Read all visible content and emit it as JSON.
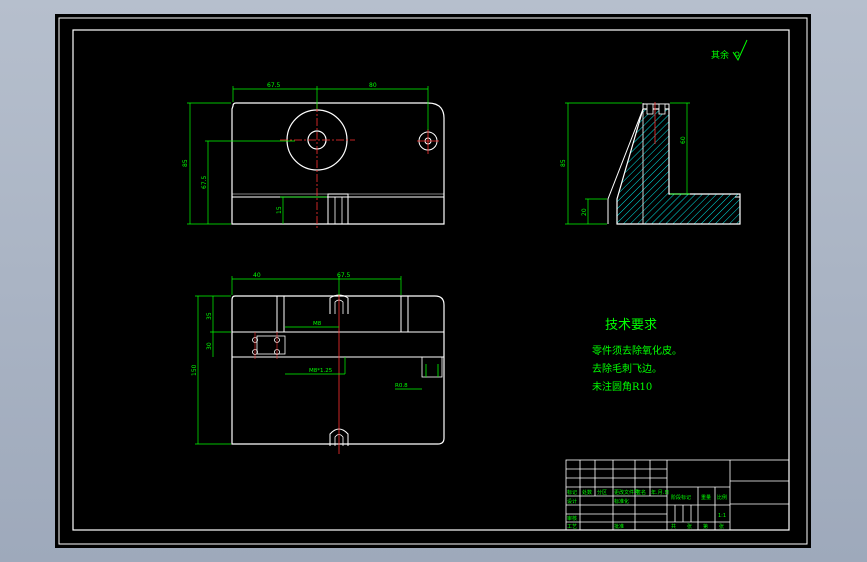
{
  "colors": {
    "background": "#000000",
    "outline": "#ffffff",
    "dimension": "#00ff00",
    "centerline": "#ff0000",
    "hatch": "#00ffff",
    "note_text": "#00ff00"
  },
  "roughness_mark": "其余",
  "tech_requirements": {
    "title": "技术要求",
    "lines": [
      "零件须去除氧化皮。",
      "去除毛刺飞边。",
      "未注圆角R10"
    ]
  },
  "dimensions": {
    "front_top_left": "67.5",
    "front_top_right": "80",
    "front_left_height": "85",
    "front_inner_height": "67.5",
    "front_slot_height": "15",
    "side_height": "85",
    "side_inner": "60",
    "side_base": "20",
    "top_left_width": "40",
    "top_right_width": "67.5",
    "top_left_upper": "35",
    "top_left_lower": "30",
    "top_total_height": "150",
    "top_center_small": "M8",
    "top_center_wide": "M8*1.25",
    "top_detail": "R0.8"
  },
  "title_block": {
    "labels": [
      "标记",
      "处数",
      "分区",
      "更改文件号",
      "签名",
      "年.月.日",
      "设计",
      "标准化",
      "审核",
      "工艺",
      "批准",
      "阶段标记",
      "重量",
      "比例",
      "共",
      "张",
      "第",
      "张"
    ],
    "scale_value": "1:1"
  }
}
